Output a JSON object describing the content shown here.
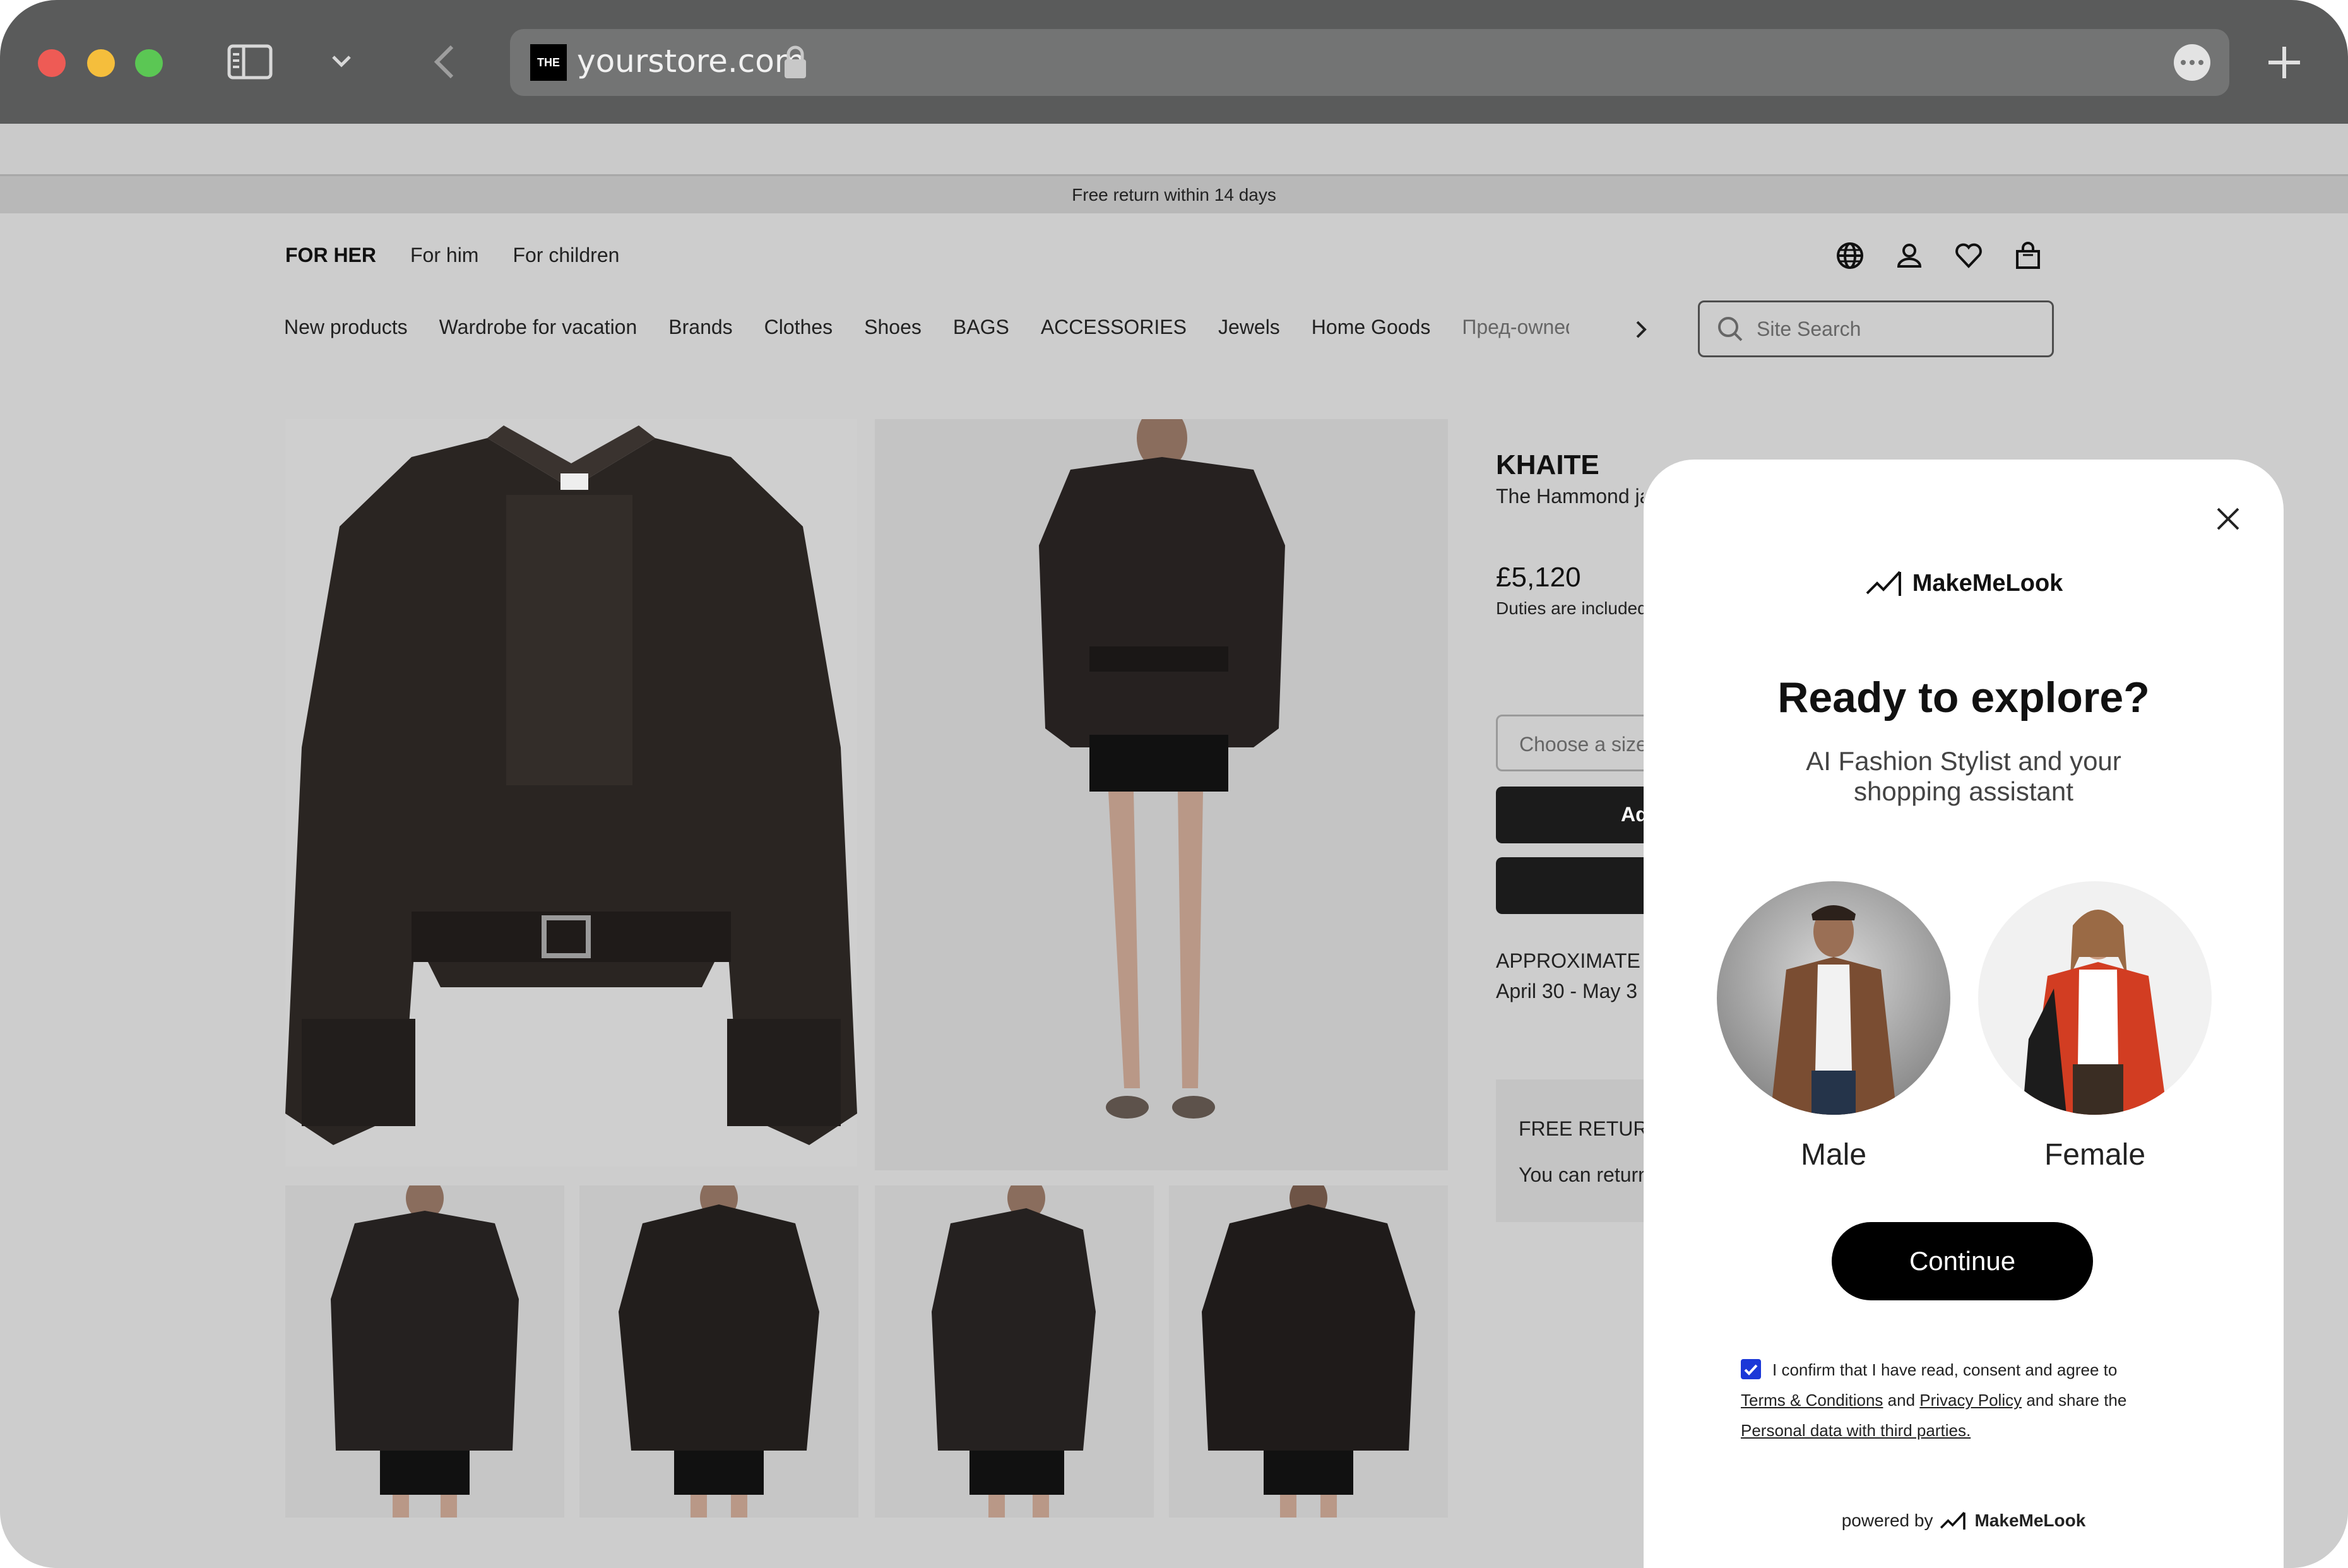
{
  "browser": {
    "url": "yourstore.com",
    "favicon_text": "THE"
  },
  "announcement": "Free return within 14 days",
  "gender_nav": [
    "FOR HER",
    "For him",
    "For children"
  ],
  "category_nav": [
    "New products",
    "Wardrobe for vacation",
    "Brands",
    "Clothes",
    "Shoes",
    "BAGS",
    "ACCESSORIES",
    "Jewels",
    "Home Goods",
    "Пред-owned"
  ],
  "search": {
    "placeholder": "Site Search"
  },
  "product": {
    "brand": "KHAITE",
    "name": "The Hammond jacket",
    "price": "£5,120",
    "duties": "Duties are included",
    "size_placeholder": "Choose a size",
    "add_label": "Add",
    "delivery_title": "APPROXIMATE",
    "delivery_dates": "April 30 - May 3",
    "returns_title": "FREE RETURNS",
    "returns_text": "You can return"
  },
  "modal": {
    "brand": "MakeMeLook",
    "title": "Ready to explore?",
    "subtitle": "AI Fashion Stylist and your shopping assistant",
    "options": [
      "Male",
      "Female"
    ],
    "continue_label": "Continue",
    "consent_prefix": "I confirm that I have read, consent and agree to",
    "terms_link": "Terms & Conditions",
    "consent_and": "and",
    "privacy_link": "Privacy Policy",
    "consent_share": "and share the",
    "personal_link": "Personal data with third parties.",
    "powered_by": "powered by"
  }
}
